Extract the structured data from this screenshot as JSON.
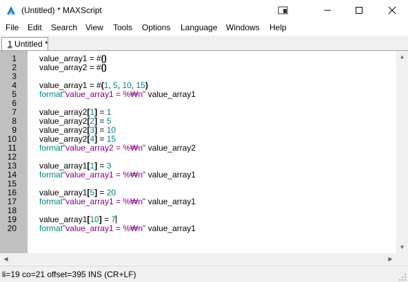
{
  "window": {
    "title": "(Untitled) * MAXScript"
  },
  "menu": [
    "File",
    "Edit",
    "Search",
    "View",
    "Tools",
    "Options",
    "Language",
    "Windows",
    "Help"
  ],
  "tab": {
    "number": "1",
    "label": "Untitled *"
  },
  "code": {
    "line_numbers": [
      "1",
      "2",
      "3",
      "4",
      "5",
      "6",
      "7",
      "8",
      "9",
      "10",
      "11",
      "12",
      "13",
      "14",
      "15",
      "16",
      "17",
      "18",
      "19",
      "20"
    ],
    "lines": [
      [
        [
          "value_array1 = #",
          "n"
        ],
        [
          "()",
          "b"
        ]
      ],
      [
        [
          "value_array2 = #",
          "n"
        ],
        [
          "()",
          "b"
        ]
      ],
      [],
      [
        [
          "value_array1 = #",
          "n"
        ],
        [
          "(",
          "b"
        ],
        [
          "1",
          "t"
        ],
        [
          ", ",
          "n"
        ],
        [
          "5",
          "t"
        ],
        [
          ", ",
          "n"
        ],
        [
          "10",
          "t"
        ],
        [
          ", ",
          "n"
        ],
        [
          "15",
          "t"
        ],
        [
          ")",
          "b"
        ]
      ],
      [
        [
          "format",
          "t"
        ],
        [
          "\"value_array1 = %₩n\"",
          "s"
        ],
        [
          " value_array1",
          "n"
        ]
      ],
      [],
      [
        [
          "value_array2",
          "n"
        ],
        [
          "[",
          "b"
        ],
        [
          "1",
          "t"
        ],
        [
          "]",
          "b"
        ],
        [
          " = ",
          "n"
        ],
        [
          "1",
          "t"
        ]
      ],
      [
        [
          "value_array2",
          "n"
        ],
        [
          "[",
          "b"
        ],
        [
          "2",
          "t"
        ],
        [
          "]",
          "b"
        ],
        [
          " = ",
          "n"
        ],
        [
          "5",
          "t"
        ]
      ],
      [
        [
          "value_array2",
          "n"
        ],
        [
          "[",
          "b"
        ],
        [
          "3",
          "t"
        ],
        [
          "]",
          "b"
        ],
        [
          " = ",
          "n"
        ],
        [
          "10",
          "t"
        ]
      ],
      [
        [
          "value_array2",
          "n"
        ],
        [
          "[",
          "b"
        ],
        [
          "4",
          "t"
        ],
        [
          "]",
          "b"
        ],
        [
          " = ",
          "n"
        ],
        [
          "15",
          "t"
        ]
      ],
      [
        [
          "format",
          "t"
        ],
        [
          "\"value_array2 = %₩n\"",
          "s"
        ],
        [
          " value_array2",
          "n"
        ]
      ],
      [],
      [
        [
          "value_array1",
          "n"
        ],
        [
          "[",
          "b"
        ],
        [
          "1",
          "t"
        ],
        [
          "]",
          "b"
        ],
        [
          " = ",
          "n"
        ],
        [
          "3",
          "t"
        ]
      ],
      [
        [
          "format",
          "t"
        ],
        [
          "\"value_array1 = %₩n\"",
          "s"
        ],
        [
          " value_array1",
          "n"
        ]
      ],
      [],
      [
        [
          "value_array1",
          "n"
        ],
        [
          "[",
          "b"
        ],
        [
          "5",
          "t"
        ],
        [
          "]",
          "b"
        ],
        [
          " = ",
          "n"
        ],
        [
          "20",
          "t"
        ]
      ],
      [
        [
          "format",
          "t"
        ],
        [
          "\"value_array1 = %₩n\"",
          "s"
        ],
        [
          " value_array1",
          "n"
        ]
      ],
      [],
      [
        [
          "value_array1",
          "n"
        ],
        [
          "[",
          "b"
        ],
        [
          "10",
          "t"
        ],
        [
          "]",
          "b"
        ],
        [
          " = ",
          "n"
        ],
        [
          "7",
          "t"
        ],
        [
          "|",
          "c"
        ]
      ],
      [
        [
          "format",
          "t"
        ],
        [
          "\"value_array1 = %₩n\"",
          "s"
        ],
        [
          " value_array1",
          "n"
        ]
      ]
    ],
    "syntax_colors": {
      "n": "#000000",
      "b": "#000000",
      "t": "#008080",
      "s": "#800080"
    }
  },
  "status": {
    "text": "li=19 co=21 offset=395 INS (CR+LF)"
  },
  "colors": {
    "gutter": "#c0c0c0",
    "app_icon": "#1f7fb0"
  },
  "icons": [
    "app-icon",
    "restore-down-icon",
    "minimize-icon",
    "maximize-icon",
    "close-icon",
    "scroll-up-icon",
    "scroll-down-icon",
    "scroll-left-icon",
    "scroll-right-icon",
    "size-grip-icon"
  ]
}
